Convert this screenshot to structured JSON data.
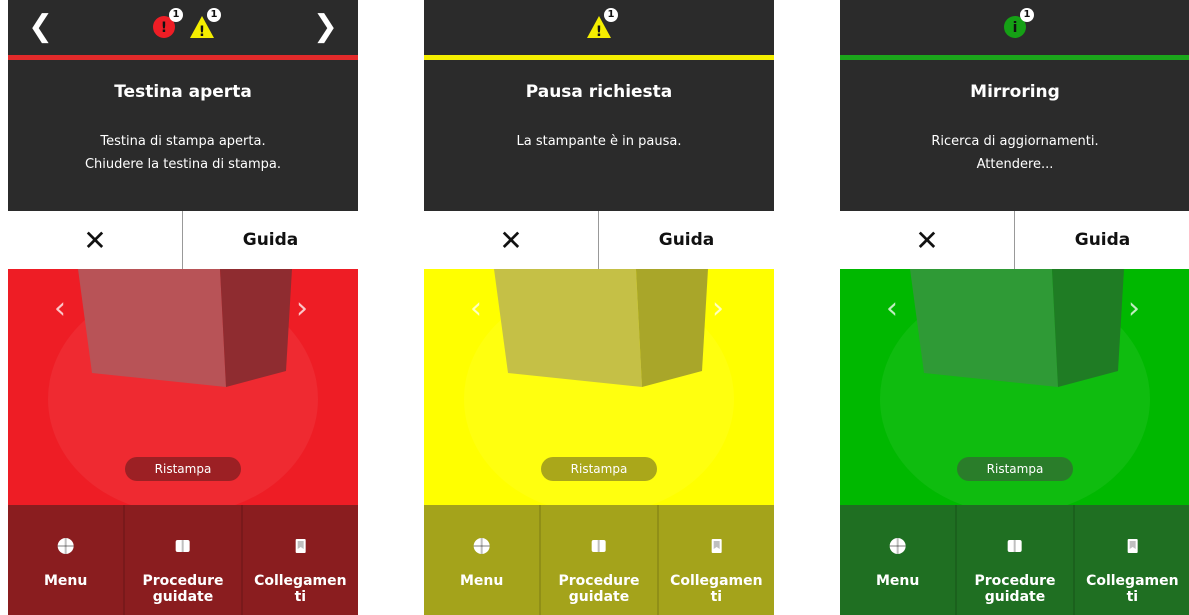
{
  "screens": [
    {
      "id": "error",
      "theme": {
        "accent": "#e22a2a",
        "panel": "#ee1d25",
        "footer": "#8a1d1f",
        "pill": "#9c2024",
        "printer": "#b85357",
        "printer_dark": "#8f2c30"
      },
      "status_icons": [
        {
          "name": "error-icon",
          "color": "#ee1d25",
          "count": "1"
        },
        {
          "name": "warning-icon",
          "color": "#f4ee00",
          "count": "1"
        }
      ],
      "show_nav_arrows": true,
      "title": "Testina aperta",
      "message": "Testina di stampa aperta.\nChiudere la testina di stampa.",
      "close_label": "✕",
      "help_label": "Guida",
      "reprint_label": "Ristampa",
      "nav": {
        "menu": "Menu",
        "guides": "Procedure\nguidate",
        "links": "Collegamen\nti"
      }
    },
    {
      "id": "warning",
      "theme": {
        "accent": "#f4ee00",
        "panel": "#ffff00",
        "footer": "#a4a31b",
        "pill": "#aaa71a",
        "printer": "#c5c046",
        "printer_dark": "#a9a629"
      },
      "status_icons": [
        {
          "name": "warning-icon",
          "color": "#f4ee00",
          "count": "1"
        }
      ],
      "show_nav_arrows": false,
      "title": "Pausa richiesta",
      "message": "La stampante è in pausa.",
      "close_label": "✕",
      "help_label": "Guida",
      "reprint_label": "Ristampa",
      "nav": {
        "menu": "Menu",
        "guides": "Procedure\nguidate",
        "links": "Collegamen\nti"
      }
    },
    {
      "id": "info",
      "theme": {
        "accent": "#1ba61b",
        "panel": "#00b800",
        "footer": "#1f6f22",
        "pill": "#2a7d2a",
        "printer": "#2f9a36",
        "printer_dark": "#1f7c24"
      },
      "status_icons": [
        {
          "name": "info-icon",
          "color": "#15a015",
          "count": "1"
        }
      ],
      "show_nav_arrows": false,
      "title": "Mirroring",
      "message": "Ricerca di aggiornamenti.\nAttendere...",
      "close_label": "✕",
      "help_label": "Guida",
      "reprint_label": "Ristampa",
      "nav": {
        "menu": "Menu",
        "guides": "Procedure\nguidate",
        "links": "Collegamen\nti"
      }
    }
  ]
}
